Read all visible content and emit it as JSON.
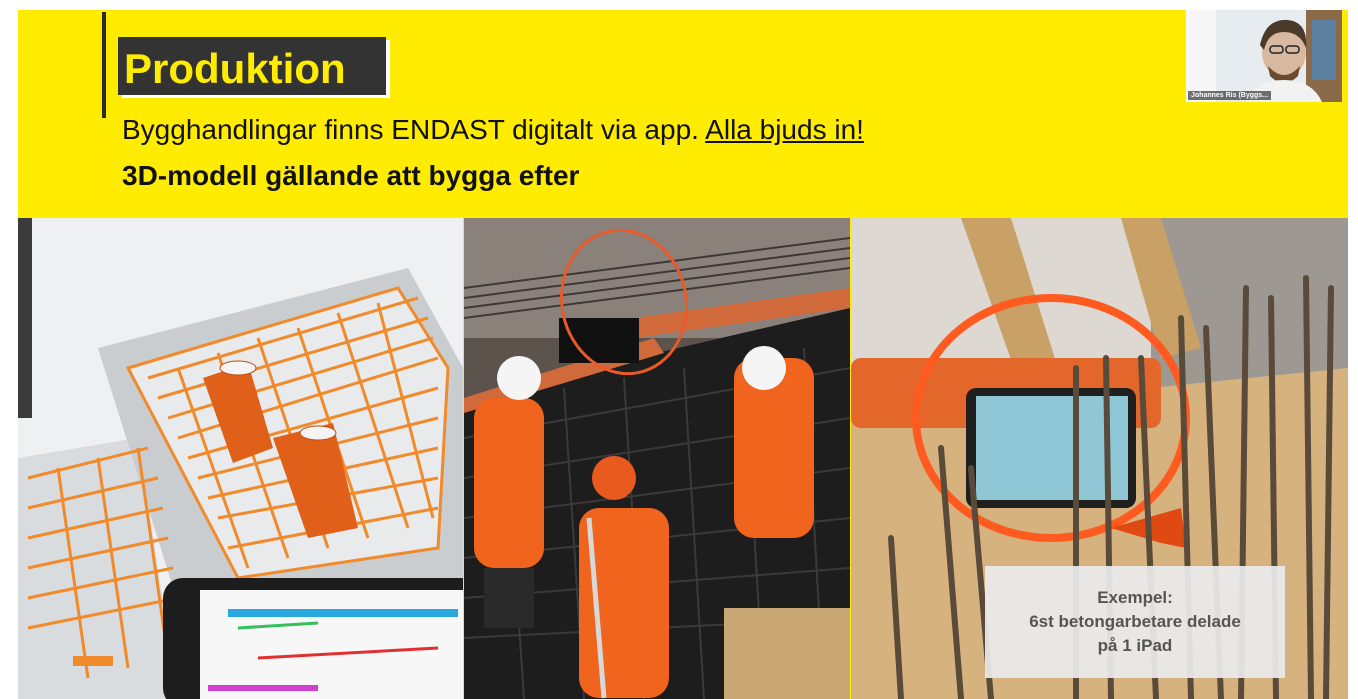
{
  "slide": {
    "title": "Produktion",
    "subtitle_text": "Bygghandlingar finns ENDAST digitalt via app.",
    "subtitle_link": "Alla bjuds in!",
    "subtitle2": "3D-modell gällande att bygga efter",
    "example": {
      "line1": "Exempel:",
      "line2": "6st betongarbetare delade",
      "line3": "på 1 iPad"
    }
  },
  "webcam": {
    "name": "Johannes Ris (Byggs..."
  },
  "colors": {
    "background": "#ffec00",
    "title_box": "#333333",
    "accent_orange": "#ff5a1f"
  }
}
